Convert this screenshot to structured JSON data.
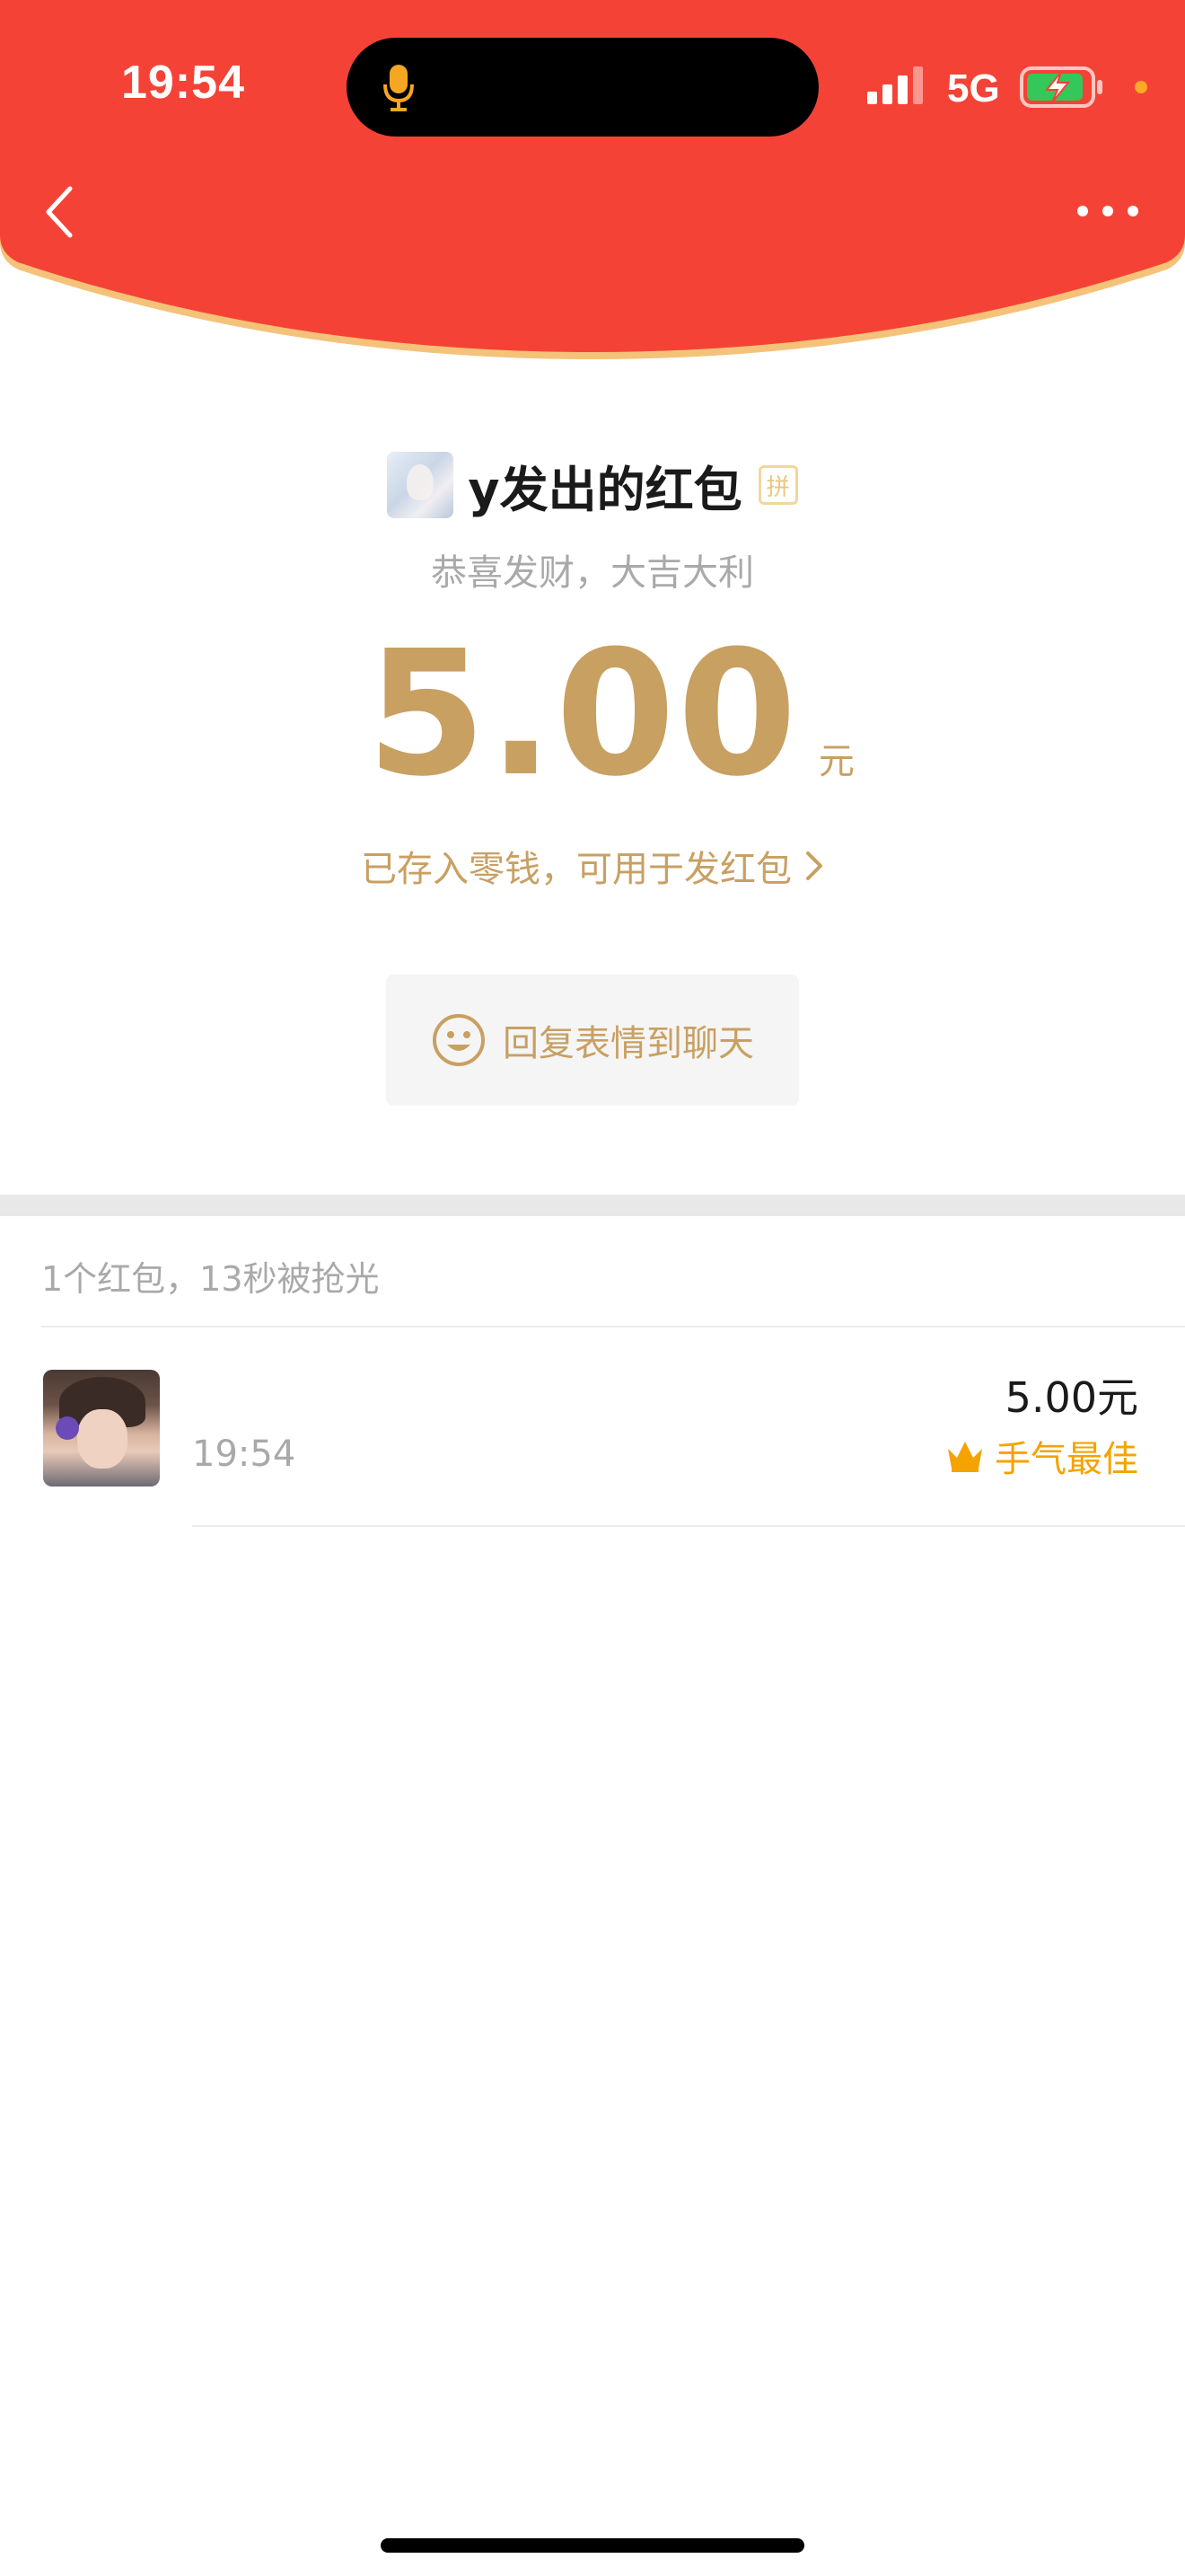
{
  "status_bar": {
    "time": "19:54",
    "network": "5G"
  },
  "nav": {
    "back_icon": "chevron-left-icon",
    "more_icon": "more-dots-icon"
  },
  "envelope": {
    "sender_title": "y发出的红包",
    "pin_badge": "拼",
    "blessing": "恭喜发财，大吉大利",
    "amount": "5.00",
    "unit": "元",
    "saved_text": "已存入零钱，可用于发红包",
    "reply_button": "回复表情到聊天"
  },
  "summary": "1个红包，13秒被抢光",
  "records": [
    {
      "time": "19:54",
      "amount": "5.00元",
      "badge": "手气最佳"
    }
  ],
  "colors": {
    "header_red": "#f44336",
    "gold": "#c8a062",
    "best_orange": "#f4a300"
  }
}
